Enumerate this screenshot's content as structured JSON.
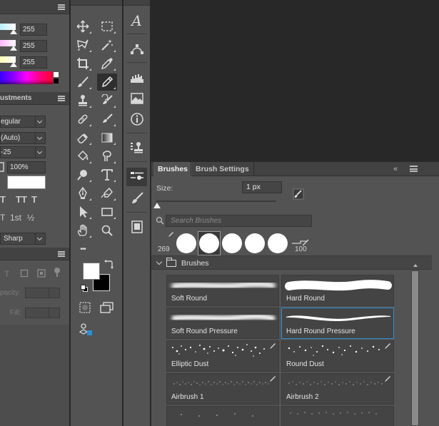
{
  "left_panel": {
    "color_values": [
      "255",
      "255",
      "255"
    ],
    "tab_title": "ustments",
    "font_style": "egular",
    "leading": "(Auto)",
    "tracking": "-25",
    "vertical_scale": "100%",
    "antialias": "Sharp",
    "opacity_label": "pacity:",
    "fill_label": "Fill:",
    "ordinal_glyph": "1st",
    "fraction_glyph": "½"
  },
  "brushes_panel": {
    "tabs": [
      "Brushes",
      "Brush Settings"
    ],
    "collapse_glyph": "«",
    "size_label": "Size:",
    "size_value": "1 px",
    "search_placeholder": "Search Brushes",
    "recent_count": "269",
    "recent_max": "100",
    "group_name": "Brushes",
    "brushes": [
      {
        "name": "Soft Round",
        "style": "soft"
      },
      {
        "name": "Hard Round",
        "style": "hard"
      },
      {
        "name": "Soft Round Pressure",
        "style": "soft-pressure"
      },
      {
        "name": "Hard Round Pressure",
        "style": "hard-pressure",
        "selected": true
      },
      {
        "name": "Elliptic Dust",
        "style": "dust"
      },
      {
        "name": "Round Dust",
        "style": "dust"
      },
      {
        "name": "Airbrush 1",
        "style": "airbrush"
      },
      {
        "name": "Airbrush 2",
        "style": "airbrush"
      }
    ]
  },
  "tools": {
    "more_glyph": "•••"
  },
  "dock": {
    "type_glyph": "A"
  },
  "colors": {
    "accent": "#2b8fd5",
    "panel_bg": "#535353",
    "header_bg": "#424242",
    "foreground": "#ffffff",
    "background": "#000000"
  }
}
